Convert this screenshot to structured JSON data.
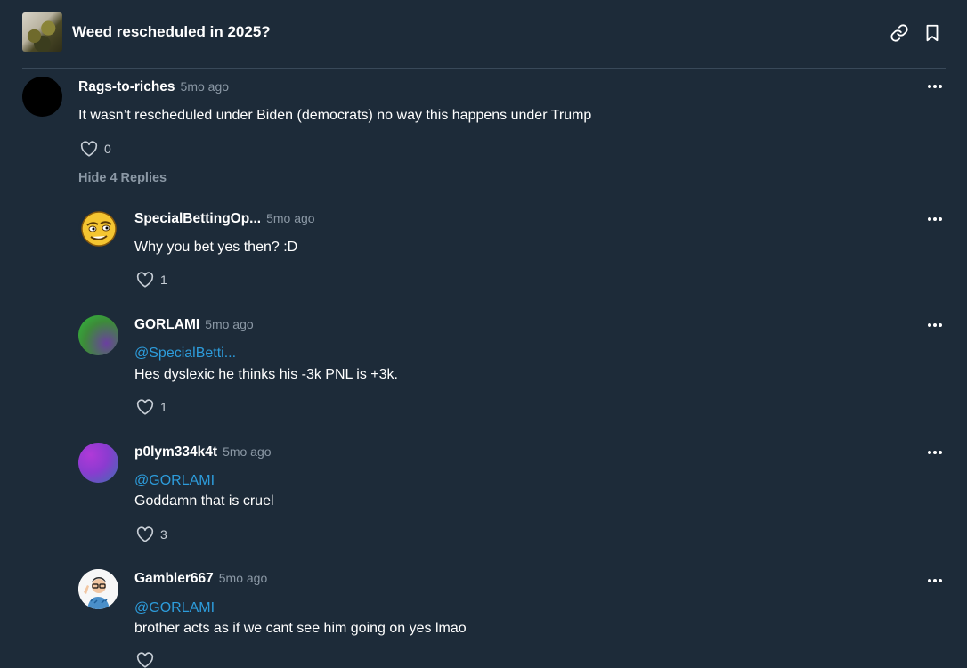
{
  "market": {
    "title": "Weed rescheduled in 2025?",
    "icons": [
      "link-icon",
      "bookmark-icon"
    ]
  },
  "hide_replies_label": "Hide 4 Replies",
  "comments": [
    {
      "username": "Rags-to-riches",
      "time": "5mo ago",
      "mention": "",
      "text": "It wasn’t rescheduled under Biden (democrats) no way this happens under Trump",
      "likes": "0"
    },
    {
      "username": "SpecialBettingOp...",
      "time": "5mo ago",
      "mention": "",
      "text": "Why you bet yes then? :D",
      "likes": "1"
    },
    {
      "username": "GORLAMI",
      "time": "5mo ago",
      "mention": "@SpecialBetti...",
      "text": "Hes dyslexic he thinks his -3k PNL is +3k.",
      "likes": "1"
    },
    {
      "username": "p0lym334k4t",
      "time": "5mo ago",
      "mention": "@GORLAMI",
      "text": "Goddamn that is cruel",
      "likes": "3"
    },
    {
      "username": "Gambler667",
      "time": "5mo ago",
      "mention": "@GORLAMI",
      "text": "brother acts as if we cant see him going on yes lmao",
      "likes": ""
    }
  ]
}
